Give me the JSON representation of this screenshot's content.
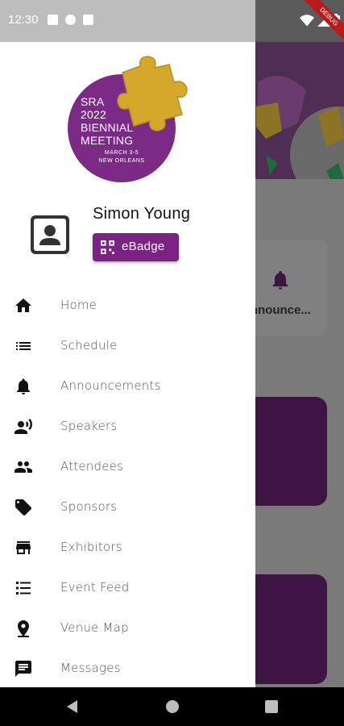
{
  "status_bar": {
    "time": "12:30",
    "debug_label": "DEBUG"
  },
  "logo": {
    "lines": [
      "SRA",
      "2022",
      "BIENNIAL",
      "MEETING"
    ],
    "dates": "MARCH 3-5",
    "location": "NEW ORLEANS",
    "color": "#7b2a86",
    "puzzle_color": "#d4a82a"
  },
  "profile": {
    "name": "Simon Young",
    "ebadge_label": "eBadge",
    "accent": "#7b2382"
  },
  "menu": {
    "items": [
      {
        "label": "Home",
        "icon": "home-icon"
      },
      {
        "label": "Schedule",
        "icon": "schedule-list-icon"
      },
      {
        "label": "Announcements",
        "icon": "bell-icon"
      },
      {
        "label": "Speakers",
        "icon": "speaker-icon"
      },
      {
        "label": "Attendees",
        "icon": "people-icon"
      },
      {
        "label": "Sponsors",
        "icon": "tag-icon"
      },
      {
        "label": "Exhibitors",
        "icon": "store-icon"
      },
      {
        "label": "Event Feed",
        "icon": "feed-list-icon"
      },
      {
        "label": "Venue Map",
        "icon": "map-pin-icon"
      },
      {
        "label": "Messages",
        "icon": "message-icon"
      }
    ]
  },
  "background": {
    "card_label": "Announce..."
  }
}
